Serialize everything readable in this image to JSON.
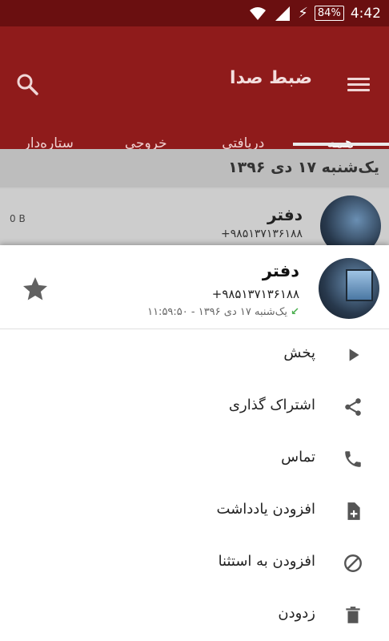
{
  "status": {
    "battery": "84%",
    "time": "4:42"
  },
  "appbar": {
    "title": "ضبط صدا",
    "tabs": [
      "همه",
      "دریافتی",
      "خروجی",
      "ستاره‌دار"
    ],
    "active_tab": 0
  },
  "list": {
    "date_header": "یک‌شنبه  ۱۷  دی  ۱۳۹۶",
    "rows": [
      {
        "name": "دفتر",
        "number": "+۹۸۵۱۳۷۱۳۶۱۸۸",
        "size": "0 B"
      }
    ]
  },
  "sheet": {
    "name": "دفتر",
    "number": "+۹۸۵۱۳۷۱۳۶۱۸۸",
    "meta": "یک‌شنبه  ۱۷  دی  ۱۳۹۶ - ۱۱:۵۹:۵۰",
    "items": [
      {
        "label": "پخش",
        "icon": "play-icon"
      },
      {
        "label": "اشتراک گذاری",
        "icon": "share-icon"
      },
      {
        "label": "تماس",
        "icon": "phone-icon"
      },
      {
        "label": "افزودن یادداشت",
        "icon": "add-note-icon"
      },
      {
        "label": "افزودن به استثنا",
        "icon": "block-icon"
      },
      {
        "label": "زدودن",
        "icon": "delete-icon"
      }
    ]
  },
  "colors": {
    "appbar": "#8f1b1b",
    "statusbar": "#6a0f10",
    "accent_green": "#4caf50"
  }
}
